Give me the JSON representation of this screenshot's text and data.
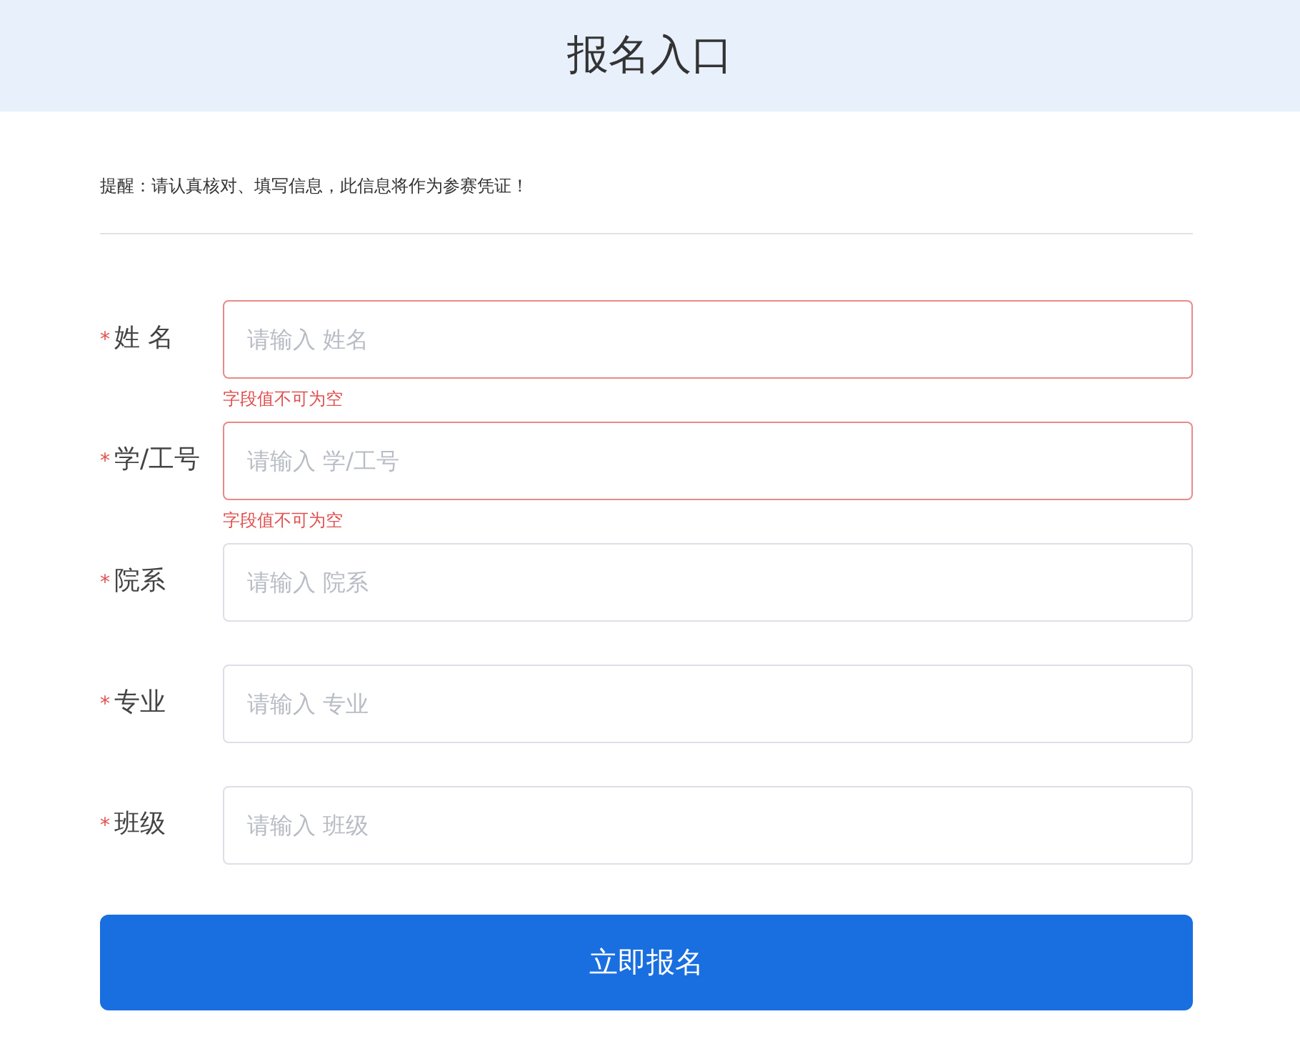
{
  "header": {
    "title": "报名入口"
  },
  "notice": "提醒：请认真核对、填写信息，此信息将作为参赛凭证！",
  "fields": [
    {
      "label": "姓 名",
      "required_mark": "*",
      "placeholder": "请输入 姓名",
      "invalid": true,
      "error": "字段值不可为空"
    },
    {
      "label": "学/工号",
      "required_mark": "*",
      "placeholder": "请输入 学/工号",
      "invalid": true,
      "error": "字段值不可为空"
    },
    {
      "label": "院系",
      "required_mark": "*",
      "placeholder": "请输入 院系",
      "invalid": false
    },
    {
      "label": "专业",
      "required_mark": "*",
      "placeholder": "请输入 专业",
      "invalid": false
    },
    {
      "label": "班级",
      "required_mark": "*",
      "placeholder": "请输入 班级",
      "invalid": false
    }
  ],
  "submit_button": "立即报名"
}
